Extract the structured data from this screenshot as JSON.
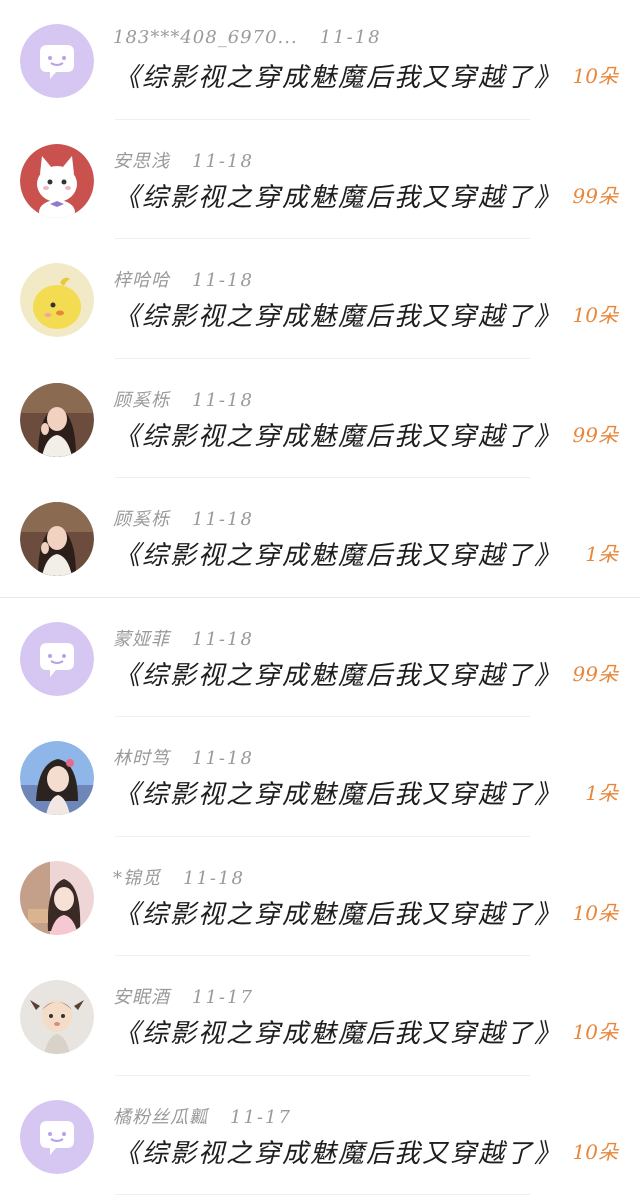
{
  "gift_color": "#e8863a",
  "entries": [
    {
      "name": "183***408_6970...",
      "date": "11-18",
      "title": "《综影视之穿成魅魔后我又穿越了》",
      "gift": "10朵",
      "avatar": "default-chat-avatar"
    },
    {
      "name": "安思浅",
      "date": "11-18",
      "title": "《综影视之穿成魅魔后我又穿越了》",
      "gift": "99朵",
      "avatar": "white-cat-avatar"
    },
    {
      "name": "梓哈哈",
      "date": "11-18",
      "title": "《综影视之穿成魅魔后我又穿越了》",
      "gift": "10朵",
      "avatar": "yellow-chick-avatar"
    },
    {
      "name": "顾奚栎",
      "date": "11-18",
      "title": "《综影视之穿成魅魔后我又穿越了》",
      "gift": "99朵",
      "avatar": "girl-photo-avatar"
    },
    {
      "name": "顾奚栎",
      "date": "11-18",
      "title": "《综影视之穿成魅魔后我又穿越了》",
      "gift": "1朵",
      "avatar": "girl-photo-avatar"
    },
    {
      "name": "蒙娅菲",
      "date": "11-18",
      "title": "《综影视之穿成魅魔后我又穿越了》",
      "gift": "99朵",
      "avatar": "default-chat-avatar"
    },
    {
      "name": "林时笃",
      "date": "11-18",
      "title": "《综影视之穿成魅魔后我又穿越了》",
      "gift": "1朵",
      "avatar": "girl-portrait-avatar"
    },
    {
      "name": "*锦觅",
      "date": "11-18",
      "title": "《综影视之穿成魅魔后我又穿越了》",
      "gift": "10朵",
      "avatar": "girl-pink-avatar"
    },
    {
      "name": "安眠酒",
      "date": "11-17",
      "title": "《综影视之穿成魅魔后我又穿越了》",
      "gift": "10朵",
      "avatar": "baby-photo-avatar"
    },
    {
      "name": "橘粉丝瓜瓤",
      "date": "11-17",
      "title": "《综影视之穿成魅魔后我又穿越了》",
      "gift": "10朵",
      "avatar": "default-chat-avatar"
    }
  ]
}
